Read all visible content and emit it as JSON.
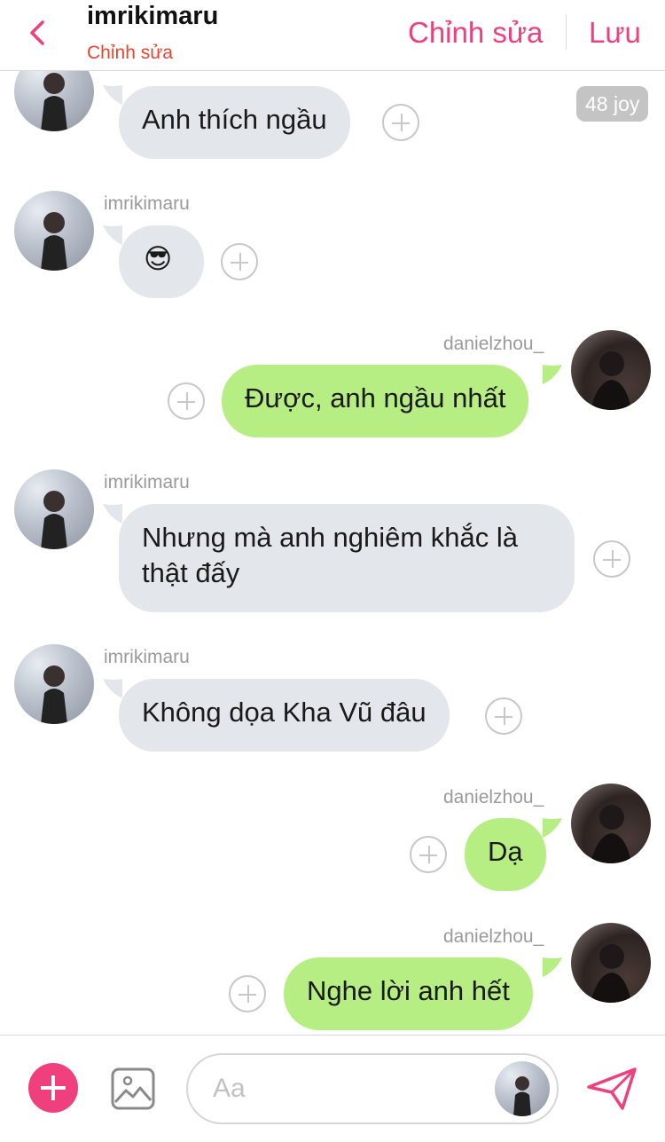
{
  "header": {
    "title": "imrikimaru",
    "subtitle": "Chỉnh sửa",
    "edit_label": "Chỉnh sửa",
    "save_label": "Lưu"
  },
  "badge": "48 joy",
  "messages": [
    {
      "sender": "",
      "text": "Anh thích ngầu",
      "direction": "incoming"
    },
    {
      "sender": "imrikimaru",
      "text": "😎",
      "direction": "incoming"
    },
    {
      "sender": "danielzhou_",
      "text": "Được, anh ngầu nhất",
      "direction": "outgoing"
    },
    {
      "sender": "imrikimaru",
      "text": "Nhưng mà anh nghiêm khắc là thật đấy",
      "direction": "incoming"
    },
    {
      "sender": "imrikimaru",
      "text": "Không dọa Kha Vũ đâu",
      "direction": "incoming"
    },
    {
      "sender": "danielzhou_",
      "text": "Dạ",
      "direction": "outgoing"
    },
    {
      "sender": "danielzhou_",
      "text": "Nghe lời anh hết",
      "direction": "outgoing"
    }
  ],
  "composer": {
    "placeholder": "Aa"
  },
  "colors": {
    "accent": "#ef3f7d",
    "subtitle": "#e8452c",
    "incoming_bubble": "#e3e6ea",
    "outgoing_bubble": "#b7ee84"
  },
  "icons": {
    "back": "chevron-left-icon",
    "add": "plus-icon",
    "image": "image-icon",
    "send": "send-icon",
    "reaction": "plus-circle-icon"
  }
}
